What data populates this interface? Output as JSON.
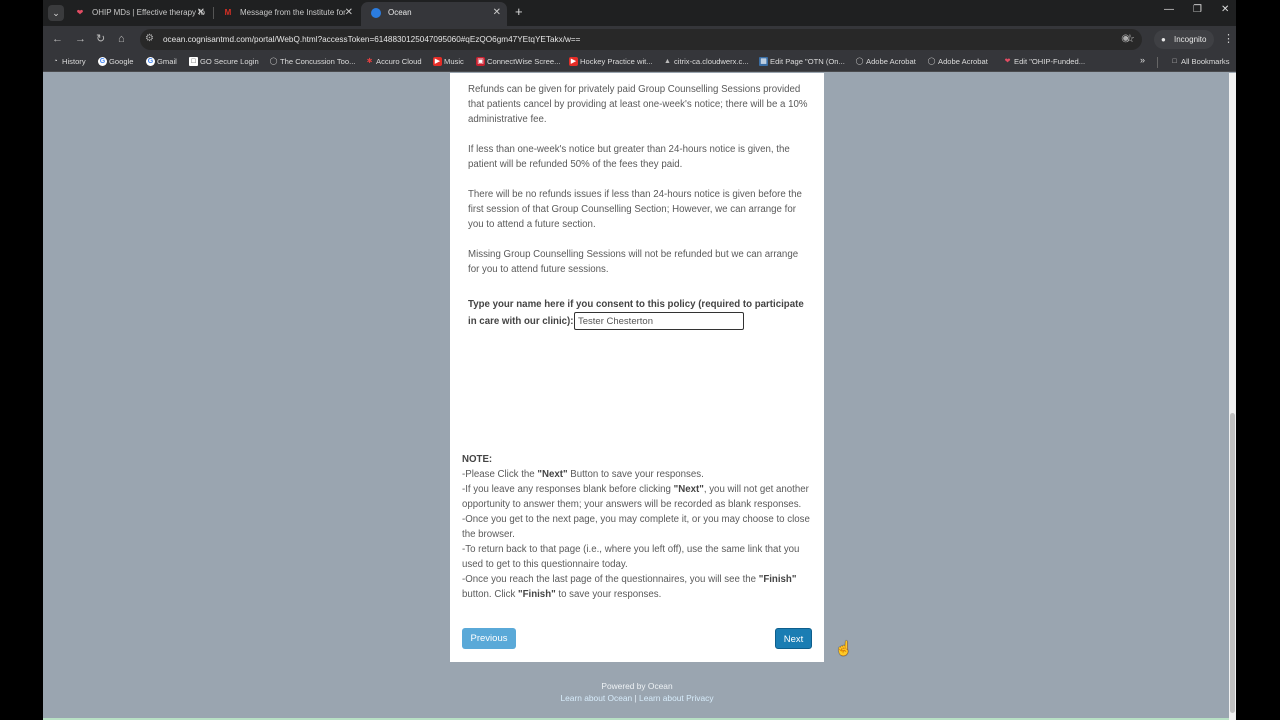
{
  "browser": {
    "tabs": [
      {
        "title": "OHIP MDs | Effective therapy fo",
        "icon": "heart-icon",
        "color": "#e24c63"
      },
      {
        "title": "Message from the Institute for",
        "icon": "gmail-icon",
        "color": "#d93025"
      },
      {
        "title": "Ocean",
        "icon": "ocean-icon",
        "color": "#2b7de1"
      }
    ],
    "url": "ocean.cognisantmd.com/portal/WebQ.html?accessToken=6148830125047095060#qEzQO6gm47YEtqYETakx/w==",
    "incognito_label": "Incognito",
    "bookmarks": [
      "History",
      "Google",
      "Gmail",
      "GO Secure Login",
      "The Concussion Too...",
      "Accuro Cloud",
      "Music",
      "ConnectWise Scree...",
      "Hockey Practice wit...",
      "citrix-ca.cloudwerx.c...",
      "Edit Page \"OTN (On...",
      "Adobe Acrobat",
      "Adobe Acrobat",
      "Edit \"OHIP-Funded..."
    ],
    "all_bookmarks_label": "All Bookmarks"
  },
  "form": {
    "paragraphs": [
      "Refunds can be given for privately paid Group Counselling Sessions provided that patients cancel by providing at least one-week's notice; there will be a 10% administrative fee.",
      "If less than one-week's notice but greater than 24-hours notice is given, the patient will be refunded 50% of the fees they paid.",
      "There will be no refunds issues if less than 24-hours notice is given before the first session of that Group Counselling Section;  However, we can arrange for you to attend a future section.",
      "Missing Group Counselling Sessions will not be refunded but we can arrange for you to attend future sessions."
    ],
    "consent_label": "Type your name here if you consent to this policy (required to participate in care with our clinic):",
    "name_value": "Tester Chesterton",
    "note_title": "NOTE:",
    "note_lines": {
      "l1a": "-Please Click the ",
      "l1b": "\"Next\"",
      "l1c": " Button to save your responses.",
      "l2a": "-If you leave any responses blank before clicking ",
      "l2b": "\"Next\"",
      "l2c": ", you will not get another opportunity to answer them; your answers will be recorded as blank responses.",
      "l3": "-Once you get to the next page, you may complete it, or you may choose to close the browser.",
      "l4": "-To return back to that page (i.e., where you left off), use the same link that you used to get to this questionnaire today.",
      "l5a": "-Once you reach the last page of the questionnaires, you will see the ",
      "l5b": "\"Finish\"",
      "l5c": " button. Click ",
      "l5d": "\"Finish\"",
      "l5e": " to save your responses."
    },
    "previous_label": "Previous",
    "next_label": "Next"
  },
  "footer": {
    "powered_by": "Powered by Ocean",
    "learn_ocean": "Learn about Ocean",
    "separator": "|",
    "learn_privacy": "Learn about Privacy"
  }
}
